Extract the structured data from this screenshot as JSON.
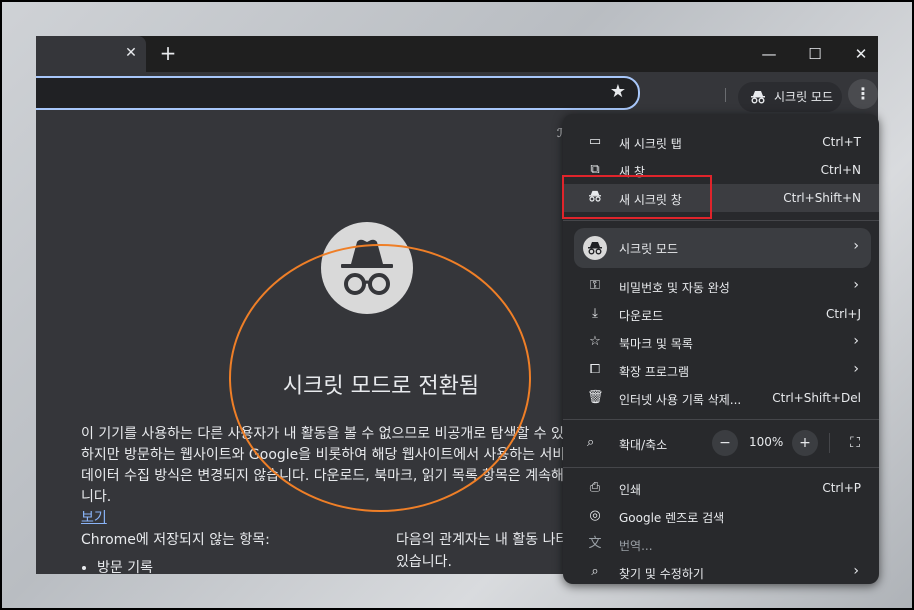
{
  "browser": {
    "new_tab_symbol": "+",
    "tab_close_symbol": "✕",
    "window_controls": {
      "minimize": "—",
      "maximize": "☐",
      "close": "✕"
    },
    "incognito_chip_label": "시크릿 모드",
    "bookmark_fragment": "ℐ"
  },
  "page": {
    "title": "시크릿 모드로 전환됨",
    "paragraph": "이 기기를 사용하는 다른 사용자가 내 활동을 볼 수 없으므로 비공개로 탐색할 수 있습니다. 하지만 방문하는 웹사이트와 Google을 비롯하여 해당 웹사이트에서 사용하는 서비스에서 데이터 수집 방식은 변경되지 않습니다. 다운로드, 북마크, 읽기 목록 항목은 계속해서 저장됩니다.",
    "paragraph_link": "보기",
    "not_saved_heading": "Chrome에 저장되지 않는 항목:",
    "not_saved_items": [
      "방문 기록"
    ],
    "visible_to_heading": "다음의 관계자는 내 활동 나타날 수 있습니다."
  },
  "menu": {
    "items": [
      {
        "label": "새 시크릿 탭",
        "shortcut": "Ctrl+T",
        "icon": "tab-icon"
      },
      {
        "label": "새 창",
        "shortcut": "Ctrl+N",
        "icon": "new-window-icon"
      },
      {
        "label": "새 시크릿 창",
        "shortcut": "Ctrl+Shift+N",
        "icon": "incognito-icon"
      }
    ],
    "profile_label": "시크릿 모드",
    "items2": [
      {
        "label": "비밀번호 및 자동 완성",
        "shortcut": "",
        "icon": "key-icon",
        "submenu": true
      },
      {
        "label": "다운로드",
        "shortcut": "Ctrl+J",
        "icon": "download-icon"
      },
      {
        "label": "북마크 및 목록",
        "shortcut": "",
        "icon": "star-icon",
        "submenu": true
      },
      {
        "label": "확장 프로그램",
        "shortcut": "",
        "icon": "puzzle-icon",
        "submenu": true
      },
      {
        "label": "인터넷 사용 기록 삭제...",
        "shortcut": "Ctrl+Shift+Del",
        "icon": "trash-icon"
      }
    ],
    "zoom_label": "확대/축소",
    "zoom_value": "100%",
    "zoom_minus": "−",
    "zoom_plus": "+",
    "items3": [
      {
        "label": "인쇄",
        "shortcut": "Ctrl+P",
        "icon": "print-icon"
      },
      {
        "label": "Google 렌즈로 검색",
        "shortcut": "",
        "icon": "lens-icon"
      },
      {
        "label": "번역...",
        "shortcut": "",
        "icon": "translate-icon"
      },
      {
        "label": "찾기 및 수정하기",
        "shortcut": "",
        "icon": "find-icon",
        "submenu": true
      }
    ]
  },
  "colors": {
    "highlight_box": "#e0242b",
    "annotation_circle": "#ef7f27",
    "link": "#8ab4f8"
  }
}
